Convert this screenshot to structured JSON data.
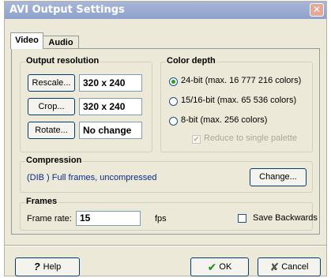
{
  "window": {
    "title": "AVI Output Settings",
    "close_glyph": "✕"
  },
  "tabs": [
    {
      "label": "Video",
      "active": true
    },
    {
      "label": "Audio",
      "active": false
    }
  ],
  "output_resolution": {
    "title": "Output resolution",
    "rescale_label": "Rescale...",
    "rescale_value": "320 x 240",
    "crop_label": "Crop...",
    "crop_value": "320 x 240",
    "rotate_label": "Rotate...",
    "rotate_value": "No change"
  },
  "color_depth": {
    "title": "Color depth",
    "options": [
      {
        "label": "24-bit  (max. 16 777 216 colors)",
        "selected": true
      },
      {
        "label": "15/16-bit  (max. 65 536 colors)",
        "selected": false
      },
      {
        "label": "8-bit  (max. 256 colors)",
        "selected": false
      }
    ],
    "reduce_label": "Reduce to single palette",
    "reduce_checked": true,
    "reduce_enabled": false
  },
  "compression": {
    "title": "Compression",
    "codec": "(DIB ) Full frames, uncompressed",
    "change_label": "Change..."
  },
  "frames": {
    "title": "Frames",
    "frame_rate_label": "Frame rate:",
    "frame_rate_value": "15",
    "fps_label": "fps",
    "save_backwards_label": "Save Backwards",
    "save_backwards_checked": false
  },
  "footer": {
    "help_label": "Help",
    "ok_label": "OK",
    "cancel_label": "Cancel"
  },
  "colors": {
    "title_bar": "#8ea1cc",
    "dialog_bg": "#ece9d8",
    "radio_selected": "#21a121"
  }
}
